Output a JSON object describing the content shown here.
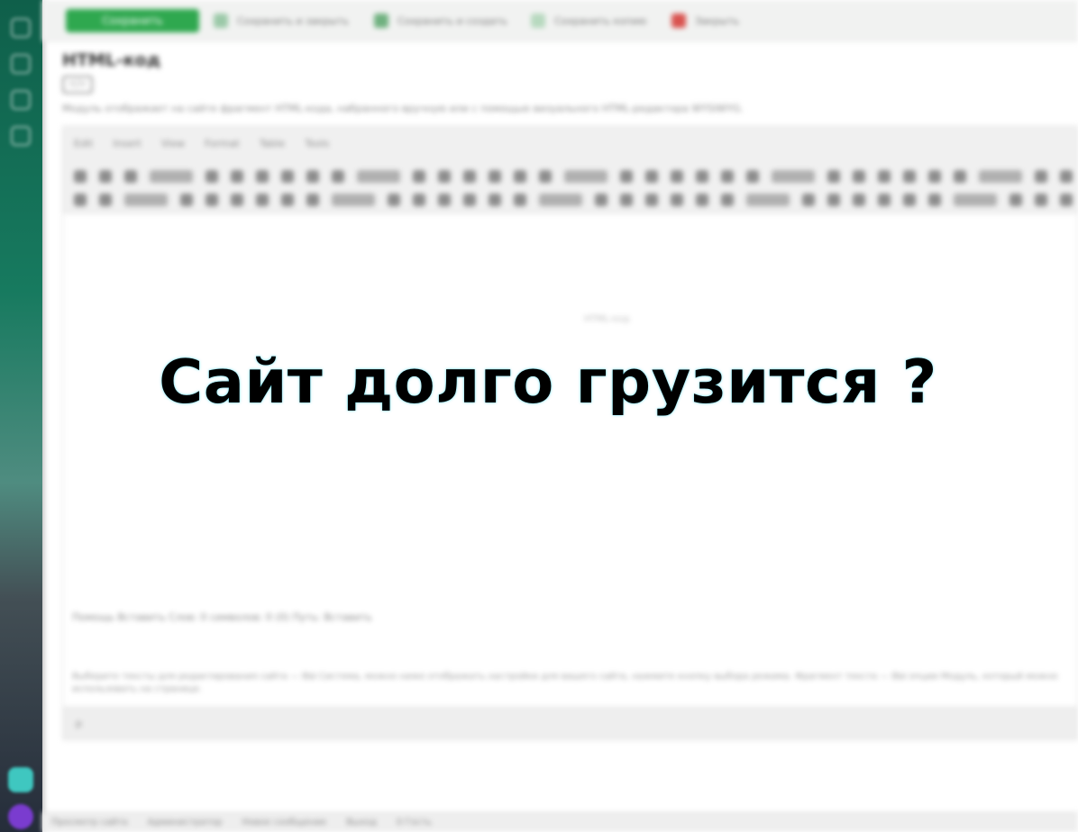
{
  "headline": "Сайт долго грузится ?",
  "topbar": {
    "primary_button": "Сохранить",
    "buttons": [
      "Сохранить и закрыть",
      "Сохранить и создать",
      "Сохранить копию",
      "Закрыть"
    ]
  },
  "page": {
    "title": "HTML-код",
    "tag": "&lt;/&gt;",
    "description": "Модуль отображает на сайте фрагмент HTML-кода, набранного вручную или с помощью визуального HTML-редактора WYSIWYG."
  },
  "editor": {
    "menu": [
      "Edit",
      "Insert",
      "View",
      "Format",
      "Table",
      "Tools"
    ],
    "content_hint": "HTML-код",
    "status": "Помощь Вставить Слов: 0 символов: 0 (0) Путь: Вставить",
    "footnote": "Выберите тексты для редактирования сайта — ВЫ Система, можно ниже отображать настройки для вашего сайта, нажмите кнопку выбора режима. Фрагмент текста — ВЫ опции Модуль, который можно использовать на странице.",
    "footer": "p"
  },
  "bottombar": {
    "items": [
      "Просмотр сайта",
      "Администратор",
      "Новое сообщение",
      "Выход",
      "0 Гость"
    ]
  },
  "colors": {
    "accent_green": "#2fa84f",
    "sidebar_top": "#0f5f4a",
    "sidebar_bottom": "#252d3a",
    "headline_glow": "#5adcf0"
  }
}
